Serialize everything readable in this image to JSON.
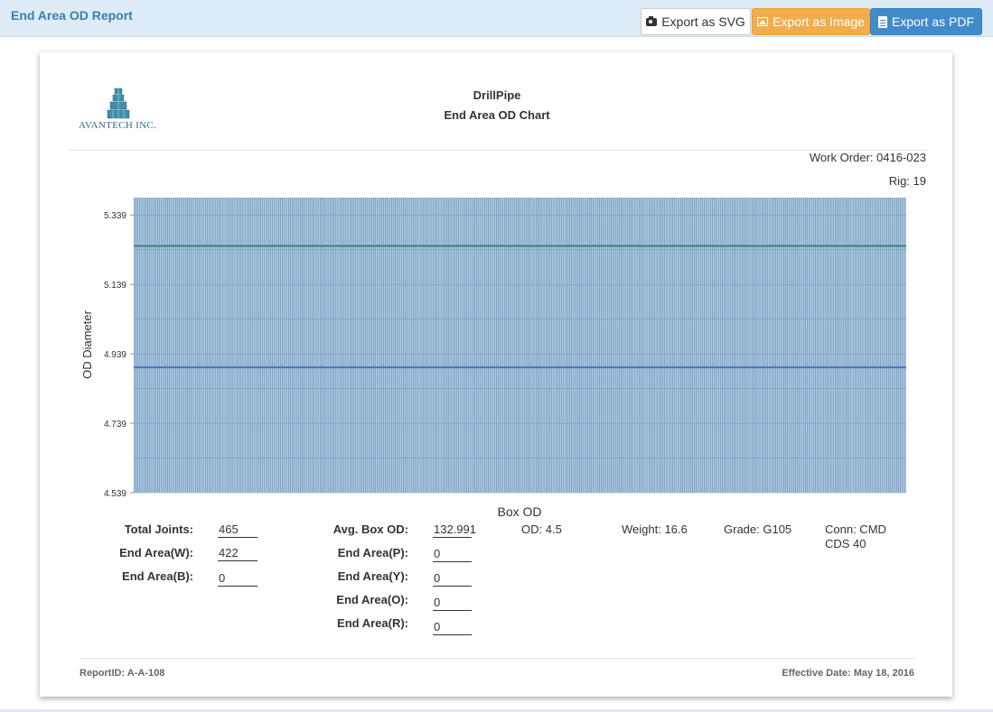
{
  "app": {
    "title": "End Area OD Report"
  },
  "toolbar": {
    "export_svg": "Export as SVG",
    "export_image": "Export as Image",
    "export_pdf": "Export as PDF"
  },
  "report": {
    "logo_text": "AVANTECH INC.",
    "title": "DrillPipe",
    "subtitle": "End Area OD Chart",
    "work_order": "Work Order: 0416-023",
    "rig": "Rig: 19"
  },
  "chart_data": {
    "type": "bar",
    "title": "",
    "xlabel": "Box OD",
    "ylabel": "OD Diameter",
    "ylim": [
      4.539,
      5.389
    ],
    "yticks": [
      "5.339",
      "5.139",
      "4.939",
      "4.739",
      "4.539"
    ],
    "bar_count": 465,
    "bar_value": 5.389,
    "bar_color": "#7ea3c8",
    "reference_lines": [
      {
        "value": 5.25,
        "color": "#3a8a6e"
      },
      {
        "value": 4.9,
        "color": "#4a6fd0"
      }
    ],
    "grid": true
  },
  "stats": {
    "total_joints_label": "Total Joints:",
    "total_joints": "465",
    "end_area_w_label": "End Area(W):",
    "end_area_w": "422",
    "end_area_b_label": "End Area(B):",
    "end_area_b": "0",
    "avg_box_od_label": "Avg. Box OD:",
    "avg_box_od": "132.991",
    "end_area_p_label": "End Area(P):",
    "end_area_p": "0",
    "end_area_y_label": "End Area(Y):",
    "end_area_y": "0",
    "end_area_o_label": "End Area(O):",
    "end_area_o": "0",
    "end_area_r_label": "End Area(R):",
    "end_area_r": "0",
    "od": "OD: 4.5",
    "weight": "Weight: 16.6",
    "grade": "Grade: G105",
    "conn": "Conn: CMD CDS 40"
  },
  "footer": {
    "report_id": "ReportID: A-A-108",
    "effective_date": "Effective Date: May 18, 2016"
  },
  "colors": {
    "accent": "#3c7cae",
    "topbar": "#dcebf5"
  }
}
